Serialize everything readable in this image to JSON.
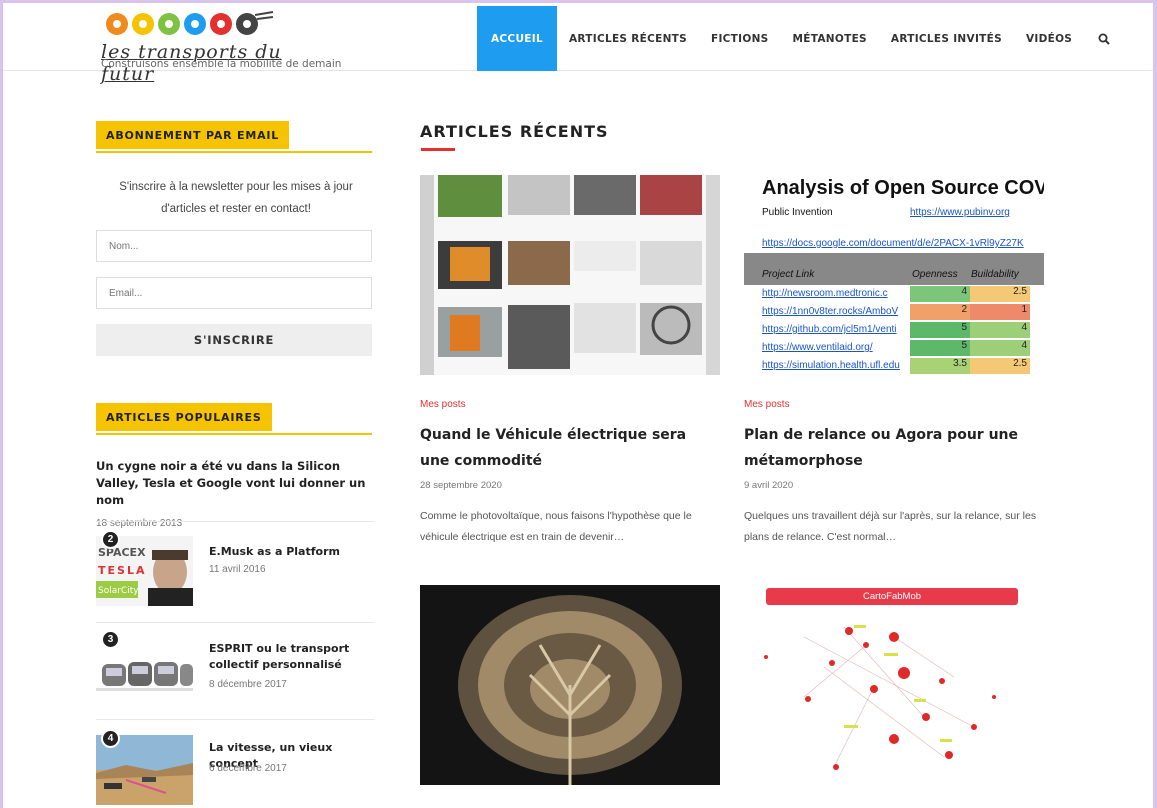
{
  "site": {
    "logo_script": "les transports du futur",
    "tagline": "Construisons ensemble la mobilité de demain"
  },
  "nav": {
    "items": [
      "ACCUEIL",
      "ARTICLES RÉCENTS",
      "FICTIONS",
      "MÉTANOTES",
      "ARTICLES INVITÉS",
      "VIDÉOS"
    ],
    "active": "ACCUEIL",
    "search_icon": "search-icon"
  },
  "sidebar": {
    "newsletter": {
      "heading": "ABONNEMENT PAR EMAIL",
      "text": "S'inscrire à la newsletter pour les mises à jour d'articles et rester en contact!",
      "name_placeholder": "Nom...",
      "email_placeholder": "Email...",
      "button": "S'INSCRIRE"
    },
    "popular": {
      "heading": "ARTICLES POPULAIRES",
      "first": {
        "title": "Un cygne noir a été vu dans la Silicon Valley, Tesla et Google vont lui donner un nom",
        "date": "18 septembre 2013"
      },
      "items": [
        {
          "num": "2",
          "title": "E.Musk as a Platform",
          "date": "11 avril 2016"
        },
        {
          "num": "3",
          "title": "ESPRIT ou le transport collectif personnalisé",
          "date": "8 décembre 2017"
        },
        {
          "num": "4",
          "title": "La vitesse, un vieux concept",
          "date": "6 décembre 2017"
        }
      ],
      "thumb_texts": {
        "spacex": "SPACEX",
        "tesla": "TESLA",
        "solarcity": "SolarCity"
      }
    }
  },
  "main": {
    "heading": "ARTICLES RÉCENTS",
    "cards": [
      {
        "category": "Mes posts",
        "title": "Quand le Véhicule électrique sera une commodité",
        "date": "28 septembre 2020",
        "excerpt": "Comme le photovoltaïque, nous faisons l'hypothèse que le véhicule électrique est en train de devenir…"
      },
      {
        "category": "Mes posts",
        "title": "Plan de relance ou Agora pour une métamorphose",
        "date": "9 avril 2020",
        "excerpt": "Quelques uns travaillent déjà sur l'après, sur la relance, sur les plans de relance. C'est normal…"
      }
    ],
    "covid_sheet": {
      "title": "Analysis of Open Source COVID-",
      "row_label": "Public Invention",
      "row_link": "https://www.pubinv.org",
      "doc_link": "https://docs.google.com/document/d/e/2PACX-1vRl9yZ27K",
      "headers": [
        "Project Link",
        "Openness",
        "Buildability"
      ],
      "rows": [
        {
          "link": "http://newsroom.medtronic.c",
          "o": "4",
          "b": "2.5"
        },
        {
          "link": "https://1nn0v8ter.rocks/AmboV",
          "o": "2",
          "b": "1"
        },
        {
          "link": "https://github.com/jcl5m1/venti",
          "o": "5",
          "b": "4"
        },
        {
          "link": "https://www.ventilaid.org/",
          "o": "5",
          "b": "4"
        },
        {
          "link": "https://simulation.health.ufl.edu",
          "o": "3.5",
          "b": "2.5"
        }
      ]
    },
    "carto_banner": "CartoFabMob",
    "colors": {
      "accent_blue": "#1e9df0",
      "accent_yellow": "#f5c300",
      "accent_red": "#e53030"
    }
  }
}
